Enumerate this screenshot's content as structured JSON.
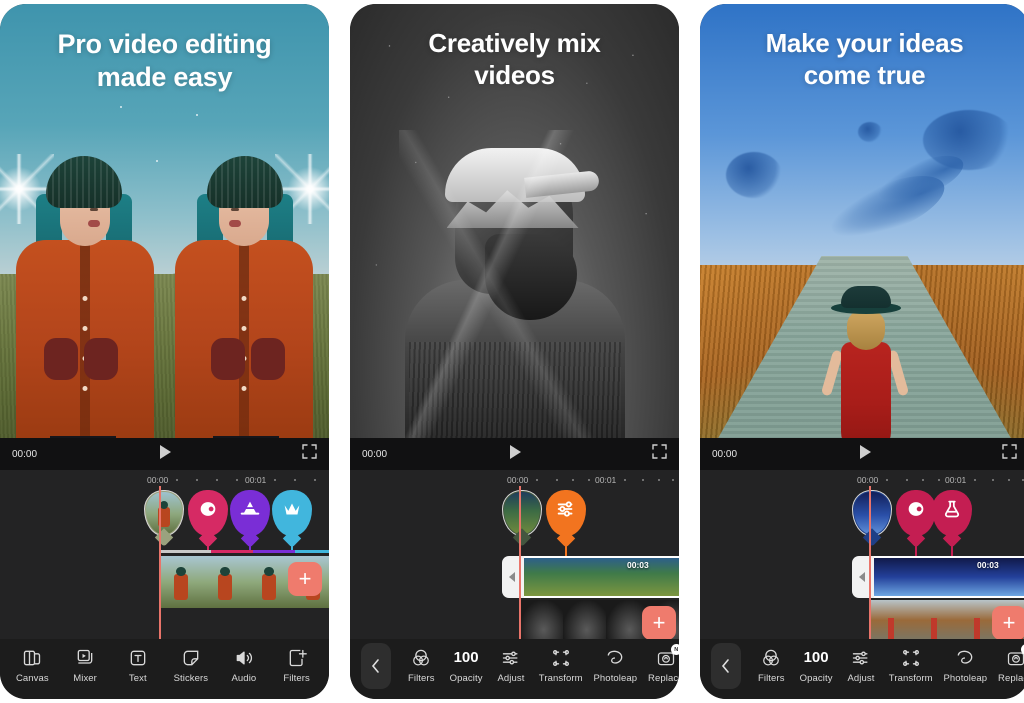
{
  "panels": [
    {
      "id": "panel-1",
      "title": "Pro video editing\nmade easy",
      "title_lines": [
        "Pro video editing",
        "made easy"
      ],
      "scene_description": "Mirrored portrait of a person in an orange raincoat and teal beanie standing in a field",
      "player": {
        "current_time": "00:00",
        "play_icon": "play-icon",
        "fullscreen_icon": "fullscreen-icon"
      },
      "timeline": {
        "ruler_labels": [
          "00:00",
          "00:01"
        ],
        "pins": [
          {
            "type": "clip-thumbnail",
            "icon": "video-thumbnail-icon",
            "color": "#9aa27e"
          },
          {
            "type": "filter",
            "icon": "lens-contrast-icon",
            "color": "#d62a64"
          },
          {
            "type": "mixer",
            "icon": "mixer-blend-icon",
            "color": "#7a2ed6"
          },
          {
            "type": "effects",
            "icon": "sparkle-crown-icon",
            "color": "#41b6dd"
          }
        ],
        "add_button_label": "+",
        "clip_duration": ""
      },
      "toolbar": {
        "has_back": false,
        "items": [
          {
            "label": "Canvas",
            "icon": "canvas-icon"
          },
          {
            "label": "Mixer",
            "icon": "mixer-icon"
          },
          {
            "label": "Text",
            "icon": "text-icon"
          },
          {
            "label": "Stickers",
            "icon": "stickers-icon"
          },
          {
            "label": "Audio",
            "icon": "audio-icon"
          },
          {
            "label": "Filters",
            "icon": "filters-icon"
          }
        ]
      }
    },
    {
      "id": "panel-2",
      "title": "Creatively mix\nvideos",
      "title_lines": [
        "Creatively mix",
        "videos"
      ],
      "scene_description": "Black and white double exposure of a bearded man in a cap blended with a mountain landscape under a starry sky",
      "player": {
        "current_time": "00:00",
        "play_icon": "play-icon",
        "fullscreen_icon": "fullscreen-icon"
      },
      "timeline": {
        "ruler_labels": [
          "00:00",
          "00:01"
        ],
        "pins": [
          {
            "type": "clip-thumbnail",
            "icon": "video-thumbnail-icon",
            "color": "#4c6b4a"
          },
          {
            "type": "adjust",
            "icon": "adjust-sliders-icon",
            "color": "#f2741f"
          }
        ],
        "add_button_label": "+",
        "clip_duration": "00:03",
        "trim_handle_icon": "trim-left-icon"
      },
      "toolbar": {
        "has_back": true,
        "back_icon": "chevron-left-icon",
        "items": [
          {
            "label": "Filters",
            "icon": "filters-circle-icon"
          },
          {
            "label": "Opacity",
            "icon": "opacity-value",
            "value": "100"
          },
          {
            "label": "Adjust",
            "icon": "adjust-sliders-icon"
          },
          {
            "label": "Transform",
            "icon": "transform-icon"
          },
          {
            "label": "Photoleap",
            "icon": "photoleap-icon"
          },
          {
            "label": "Replace",
            "icon": "replace-camera-icon",
            "badge": "N"
          }
        ]
      }
    },
    {
      "id": "panel-3",
      "title": "Make your ideas\ncome true",
      "title_lines": [
        "Make your ideas",
        "come true"
      ],
      "scene_description": "Woman in a red dress and black hat walking down a country road with blue ink clouds in the sky",
      "player": {
        "current_time": "00:00",
        "play_icon": "play-icon",
        "fullscreen_icon": "fullscreen-icon"
      },
      "timeline": {
        "ruler_labels": [
          "00:00",
          "00:01"
        ],
        "pins": [
          {
            "type": "clip-thumbnail",
            "icon": "video-thumbnail-icon",
            "color": "#1f3f86"
          },
          {
            "type": "filter",
            "icon": "lens-contrast-icon",
            "color": "#c41e52"
          },
          {
            "type": "potion",
            "icon": "flask-potion-icon",
            "color": "#c41e52"
          }
        ],
        "add_button_label": "+",
        "clip_duration": "00:03",
        "trim_handle_icon": "trim-left-icon"
      },
      "toolbar": {
        "has_back": true,
        "back_icon": "chevron-left-icon",
        "items": [
          {
            "label": "Filters",
            "icon": "filters-circle-icon"
          },
          {
            "label": "Opacity",
            "icon": "opacity-value",
            "value": "100"
          },
          {
            "label": "Adjust",
            "icon": "adjust-sliders-icon"
          },
          {
            "label": "Transform",
            "icon": "transform-icon"
          },
          {
            "label": "Photoleap",
            "icon": "photoleap-icon"
          },
          {
            "label": "Replace",
            "icon": "replace-camera-icon",
            "badge": "N"
          }
        ]
      }
    }
  ],
  "colors": {
    "accent_add": "#ef7b6d",
    "playhead": "#e9746a",
    "toolbar_bg": "#1c1c1c",
    "timeline_bg": "#232324",
    "player_bg": "#111112",
    "pin_pink": "#d62a64",
    "pin_purple": "#7a2ed6",
    "pin_cyan": "#41b6dd",
    "pin_orange": "#f2741f",
    "pin_crimson": "#c41e52"
  }
}
